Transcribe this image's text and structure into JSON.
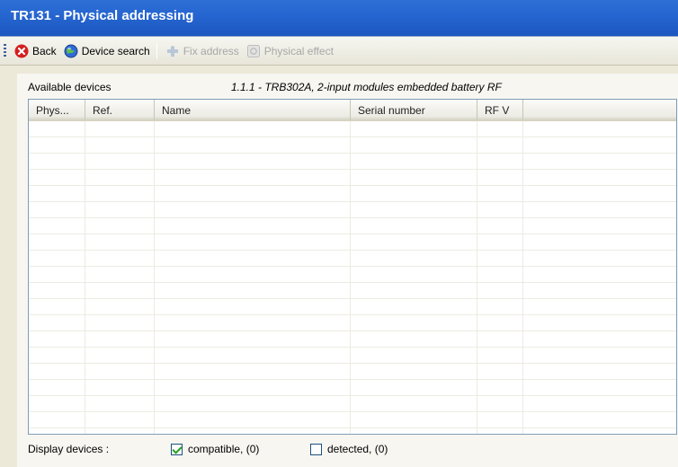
{
  "window": {
    "title": "TR131 - Physical addressing"
  },
  "toolbar": {
    "back_label": "Back",
    "device_search_label": "Device search",
    "fix_address_label": "Fix address",
    "physical_effect_label": "Physical effect"
  },
  "panel": {
    "available_label": "Available devices",
    "device_title": "1.1.1 - TRB302A, 2-input modules embedded battery RF"
  },
  "table": {
    "columns": [
      "Phys...",
      "Ref.",
      "Name",
      "Serial number",
      "RF V"
    ],
    "rows": []
  },
  "footer": {
    "display_label": "Display devices :",
    "compatible_label": "compatible, (0)",
    "compatible_checked": true,
    "detected_label": "detected, (0)",
    "detected_checked": false
  },
  "colors": {
    "title_bar": "#2565cf",
    "back_icon": "#d42020",
    "search_icon": "#2f6bd6"
  }
}
